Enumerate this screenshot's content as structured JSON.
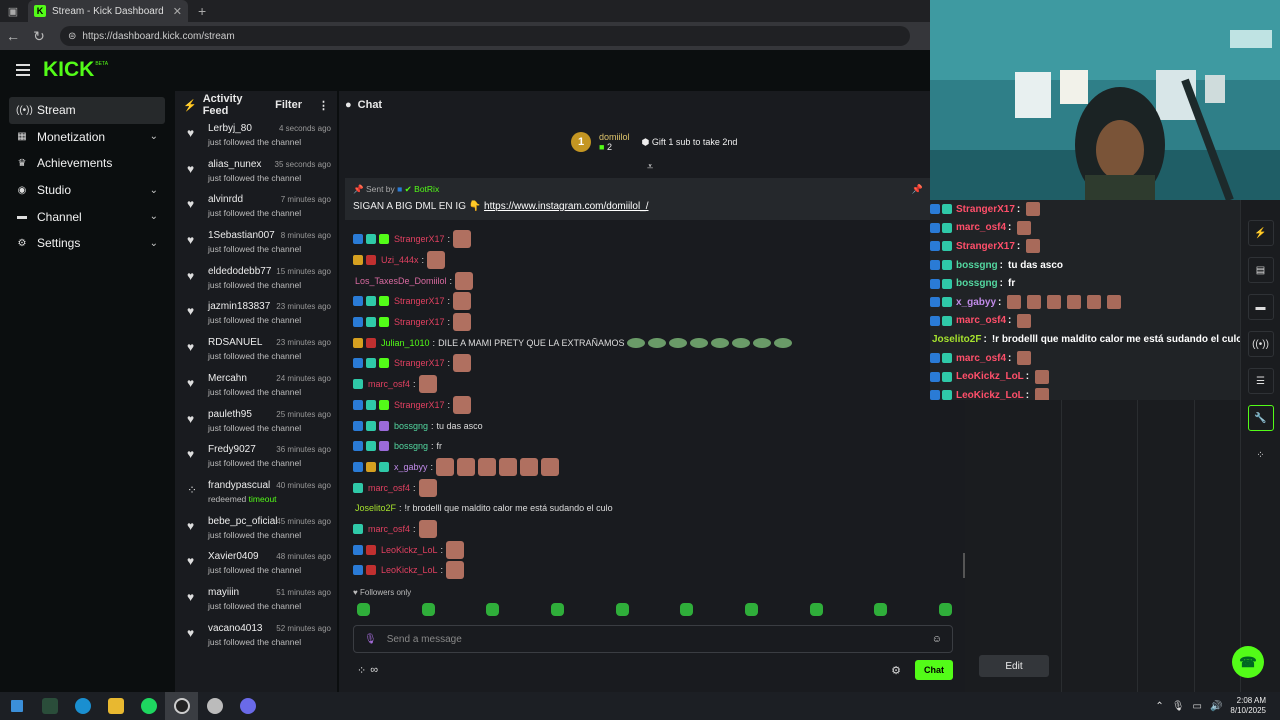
{
  "browser": {
    "tab_title": "Stream - Kick Dashboard",
    "url": "https://dashboard.kick.com/stream"
  },
  "brand": {
    "logo": "KICK",
    "beta": "BETA",
    "accent": "#53fc18"
  },
  "sidebar": {
    "items": [
      {
        "label": "Stream",
        "icon": "broadcast-icon",
        "active": true,
        "chevron": false
      },
      {
        "label": "Monetization",
        "icon": "money-icon",
        "active": false,
        "chevron": true
      },
      {
        "label": "Achievements",
        "icon": "trophy-icon",
        "active": false,
        "chevron": false
      },
      {
        "label": "Studio",
        "icon": "studio-icon",
        "active": false,
        "chevron": true
      },
      {
        "label": "Channel",
        "icon": "channel-icon",
        "active": false,
        "chevron": true
      },
      {
        "label": "Settings",
        "icon": "gear-icon",
        "active": false,
        "chevron": true
      }
    ]
  },
  "activity": {
    "title": "Activity Feed",
    "filter": "Filter",
    "items": [
      {
        "user": "Lerbyj_80",
        "time": "4 seconds ago",
        "desc": "just followed the channel",
        "icon": "heart-icon"
      },
      {
        "user": "alias_nunex",
        "time": "35 seconds ago",
        "desc": "just followed the channel",
        "icon": "heart-icon"
      },
      {
        "user": "alvinrdd",
        "time": "7 minutes ago",
        "desc": "just followed the channel",
        "icon": "heart-icon"
      },
      {
        "user": "1Sebastian007",
        "time": "8 minutes ago",
        "desc": "just followed the channel",
        "icon": "heart-icon"
      },
      {
        "user": "eldedodebb77",
        "time": "15 minutes ago",
        "desc": "just followed the channel",
        "icon": "heart-icon"
      },
      {
        "user": "jazmin183837",
        "time": "23 minutes ago",
        "desc": "just followed the channel",
        "icon": "heart-icon"
      },
      {
        "user": "RDSANUEL",
        "time": "23 minutes ago",
        "desc": "just followed the channel",
        "icon": "heart-icon"
      },
      {
        "user": "Mercahn",
        "time": "24 minutes ago",
        "desc": "just followed the channel",
        "icon": "heart-icon"
      },
      {
        "user": "pauleth95",
        "time": "25 minutes ago",
        "desc": "just followed the channel",
        "icon": "heart-icon"
      },
      {
        "user": "Fredy9027",
        "time": "36 minutes ago",
        "desc": "just followed the channel",
        "icon": "heart-icon"
      },
      {
        "user": "frandypascual",
        "time": "40 minutes ago",
        "desc": "redeemed",
        "desc_hl": "timeout",
        "icon": "points-icon"
      },
      {
        "user": "bebe_pc_oficial",
        "time": "45 minutes ago",
        "desc": "just followed the channel",
        "icon": "heart-icon"
      },
      {
        "user": "Xavier0409",
        "time": "48 minutes ago",
        "desc": "just followed the channel",
        "icon": "heart-icon"
      },
      {
        "user": "mayiiin",
        "time": "51 minutes ago",
        "desc": "just followed the channel",
        "icon": "heart-icon"
      },
      {
        "user": "vacano4013",
        "time": "52 minutes ago",
        "desc": "just followed the channel",
        "icon": "heart-icon"
      }
    ]
  },
  "chat": {
    "title": "Chat",
    "leader": {
      "rank": "1",
      "name": "domiilol",
      "count": "2",
      "gift": "Gift 1 sub to take 2nd"
    },
    "pinned": {
      "sent_by": "Sent by",
      "author": "BotRix",
      "text": "SIGAN A BIG DML EN IG 👇",
      "link": "https://www.instagram.com/domiilol_/"
    },
    "messages": [
      {
        "user": "StrangerX17",
        "color": "#e04060",
        "text": "",
        "emotes": 1,
        "badges": [
          "#2a7bd6",
          "#2fc9a8",
          "#53fc18"
        ]
      },
      {
        "user": "Uzi_444x",
        "color": "#e04060",
        "text": "",
        "emotes": 1,
        "badges": [
          "#d6a020",
          "#c03030"
        ]
      },
      {
        "user": "Los_TaxesDe_Domiilol",
        "color": "#d86aa0",
        "text": "",
        "emotes": 1,
        "badges": []
      },
      {
        "user": "StrangerX17",
        "color": "#e04060",
        "text": "",
        "emotes": 1,
        "badges": [
          "#2a7bd6",
          "#2fc9a8",
          "#53fc18"
        ]
      },
      {
        "user": "StrangerX17",
        "color": "#e04060",
        "text": "",
        "emotes": 1,
        "badges": [
          "#2a7bd6",
          "#2fc9a8",
          "#53fc18"
        ]
      },
      {
        "user": "Julian_1010",
        "color": "#53fc18",
        "text": "DILE A MAMI PRETY QUE LA EXTRAÑAMOS",
        "emotes": 0,
        "greenemotes": 8,
        "badges": [
          "#d6a020",
          "#c03030"
        ]
      },
      {
        "user": "StrangerX17",
        "color": "#e04060",
        "text": "",
        "emotes": 1,
        "badges": [
          "#2a7bd6",
          "#2fc9a8",
          "#53fc18"
        ]
      },
      {
        "user": "marc_osf4",
        "color": "#e04060",
        "text": "",
        "emotes": 1,
        "badges": [
          "#2fc9a8"
        ]
      },
      {
        "user": "StrangerX17",
        "color": "#e04060",
        "text": "",
        "emotes": 1,
        "badges": [
          "#2a7bd6",
          "#2fc9a8",
          "#53fc18"
        ]
      },
      {
        "user": "bossgng",
        "color": "#53d7a0",
        "text": "tu das asco",
        "emotes": 0,
        "badges": [
          "#2a7bd6",
          "#2fc9a8",
          "#9a6ad8"
        ]
      },
      {
        "user": "bossgng",
        "color": "#53d7a0",
        "text": "fr",
        "emotes": 0,
        "badges": [
          "#2a7bd6",
          "#2fc9a8",
          "#9a6ad8"
        ]
      },
      {
        "user": "x_gabyy",
        "color": "#c08ae8",
        "text": "",
        "emotes": 6,
        "badges": [
          "#2a7bd6",
          "#d6a020",
          "#2fc9a8"
        ]
      },
      {
        "user": "marc_osf4",
        "color": "#e04060",
        "text": "",
        "emotes": 1,
        "badges": [
          "#2fc9a8"
        ]
      },
      {
        "user": "Joselito2F",
        "color": "#a6e22e",
        "text": "!r brodelll que maldito calor me está sudando el culo",
        "emotes": 0,
        "badges": []
      },
      {
        "user": "marc_osf4",
        "color": "#e04060",
        "text": "",
        "emotes": 1,
        "badges": [
          "#2fc9a8"
        ]
      },
      {
        "user": "LeoKickz_LoL",
        "color": "#e04060",
        "text": "",
        "emotes": 1,
        "badges": [
          "#2a7bd6",
          "#c03030"
        ]
      },
      {
        "user": "LeoKickz_LoL",
        "color": "#e04060",
        "text": "",
        "emotes": 1,
        "badges": [
          "#2a7bd6",
          "#c03030"
        ]
      }
    ],
    "followers_only": "Followers only",
    "input_placeholder": "Send a message",
    "chat_button": "Chat",
    "infinity": "∞"
  },
  "overlay_chat": [
    {
      "user": "StrangerX17",
      "color": "#ff4f6a",
      "text": "",
      "emotes": 1
    },
    {
      "user": "marc_osf4",
      "color": "#ff4f6a",
      "text": "",
      "emotes": 1
    },
    {
      "user": "StrangerX17",
      "color": "#ff4f6a",
      "text": "",
      "emotes": 1
    },
    {
      "user": "bossgng",
      "color": "#53d7a0",
      "text": "tu das asco",
      "emotes": 0
    },
    {
      "user": "bossgng",
      "color": "#53d7a0",
      "text": "fr",
      "emotes": 0
    },
    {
      "user": "x_gabyy",
      "color": "#c08ae8",
      "text": "",
      "emotes": 6
    },
    {
      "user": "marc_osf4",
      "color": "#ff4f6a",
      "text": "",
      "emotes": 1
    },
    {
      "user": "Joselito2F",
      "color": "#a6e22e",
      "text": "!r brodelll que maldito calor me está sudando el culo",
      "emotes": 0
    },
    {
      "user": "marc_osf4",
      "color": "#ff4f6a",
      "text": "",
      "emotes": 1
    },
    {
      "user": "LeoKickz_LoL",
      "color": "#ff4f6a",
      "text": "",
      "emotes": 1
    },
    {
      "user": "LeoKickz_LoL",
      "color": "#ff4f6a",
      "text": "",
      "emotes": 1
    }
  ],
  "right_panel": {
    "edit_button": "Edit"
  },
  "taskbar": {
    "time": "2:08 AM",
    "date": "8/10/2025"
  }
}
